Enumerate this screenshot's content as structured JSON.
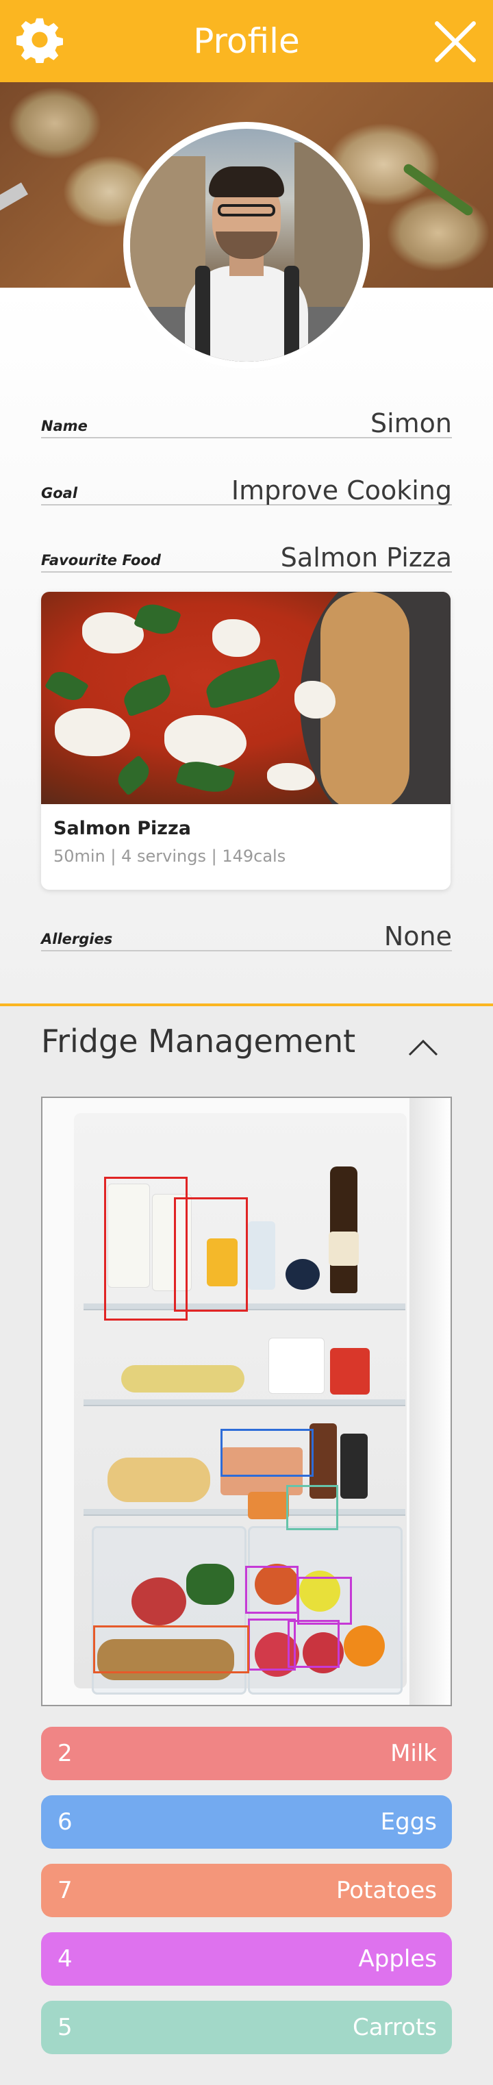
{
  "header": {
    "title": "Profile",
    "settings_icon": "gear-icon",
    "close_icon": "close-icon"
  },
  "profile": {
    "fields": [
      {
        "label": "Name",
        "value": "Simon"
      },
      {
        "label": "Goal",
        "value": "Improve Cooking"
      },
      {
        "label": "Favourite Food",
        "value": "Salmon Pizza"
      },
      {
        "label": "Allergies",
        "value": "None"
      }
    ],
    "favourite_card": {
      "name": "Salmon Pizza",
      "meta": "50min | 4 servings | 149cals"
    }
  },
  "fridge": {
    "title": "Fridge Management",
    "toggle_icon": "chevron-up-icon",
    "items": [
      {
        "count": "2",
        "name": "Milk",
        "color": "#f08585"
      },
      {
        "count": "6",
        "name": "Eggs",
        "color": "#73aaf0"
      },
      {
        "count": "7",
        "name": "Potatoes",
        "color": "#f4967a"
      },
      {
        "count": "4",
        "name": "Apples",
        "color": "#de72ee"
      },
      {
        "count": "5",
        "name": "Carrots",
        "color": "#a2d8c8"
      }
    ]
  },
  "colors": {
    "accent": "#fbb621"
  }
}
